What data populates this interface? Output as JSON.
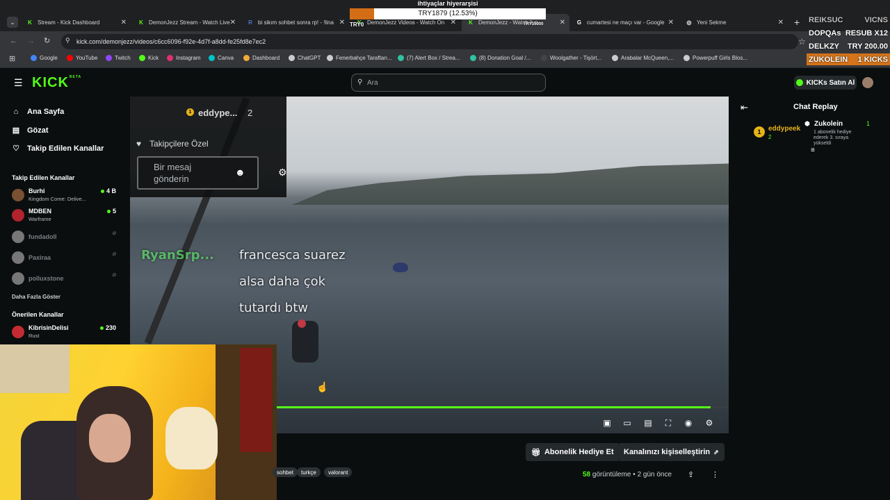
{
  "browser": {
    "tabs": [
      {
        "label": "Stream - Kick Dashboard",
        "fav": "K",
        "color": "#53fc18"
      },
      {
        "label": "DemonJezz Stream - Watch Live",
        "fav": "K",
        "color": "#53fc18"
      },
      {
        "label": "bi sikım sohbet sonra rp! - !lina",
        "fav": "R",
        "color": "#4b74d6"
      },
      {
        "label": "DemonJezz Videos - Watch On",
        "fav": "K",
        "color": "#53fc18"
      },
      {
        "label": "DemonJezz - Watch live",
        "fav": "K",
        "color": "#53fc18"
      },
      {
        "label": "cumartesi ne maçı var - Google",
        "fav": "G",
        "color": "#ffffff"
      },
      {
        "label": "Yeni Sekme",
        "fav": "◎",
        "color": "#ffffff"
      }
    ],
    "url": "kick.com/demonjezz/videos/c6cc6096-f92e-4d7f-a8dd-fe25fd8e7ec2",
    "bookmarks": [
      {
        "label": "Google",
        "color": "#4285f4"
      },
      {
        "label": "YouTube",
        "color": "#ff0000"
      },
      {
        "label": "Twitch",
        "color": "#9146ff"
      },
      {
        "label": "Kick",
        "color": "#53fc18"
      },
      {
        "label": "Instagram",
        "color": "#e1306c"
      },
      {
        "label": "Canva",
        "color": "#00c4cc"
      },
      {
        "label": "Dashboard",
        "color": "#f2a93b"
      },
      {
        "label": "ChatGPT",
        "color": "#cccccc"
      },
      {
        "label": "Fenerbahçe Taraftarı...",
        "color": "#cccccc"
      },
      {
        "label": "(7) Alert Box / Strea...",
        "color": "#31c3a2"
      },
      {
        "label": "(8) Donation Goal /...",
        "color": "#31c3a2"
      },
      {
        "label": "Woolgather - Tişört...",
        "color": "#444444"
      },
      {
        "label": "Arabalar McQueen,...",
        "color": "#cccccc"
      },
      {
        "label": "Powerpuff Girls Blos...",
        "color": "#cccccc"
      }
    ]
  },
  "stream_overlay": {
    "goal_title": "ihtiyaçlar hiyerarşisi",
    "goal_amount": "TRY1879 (12.53%)",
    "goal_progress": 0.1253,
    "goal_start": "TRY0",
    "goal_end": "TRY15000",
    "hud_lines": [
      {
        "left": "REIKSUC",
        "right": "VICNS",
        "color": "#bfbfbf"
      },
      {
        "left": "DOPQAs",
        "right": "RESUB X12",
        "color": "#ffffff"
      },
      {
        "left": "DELKZY",
        "right": "TRY 200.00",
        "color": "#ffffff"
      },
      {
        "left": "ZUKOLEIN",
        "right": "1 KICKS",
        "color": "#ffffff"
      }
    ]
  },
  "header": {
    "logo": "KICK",
    "logo_badge": "BETA",
    "search_placeholder": "Ara",
    "buy_kicks": "KICKs Satın Al"
  },
  "sidebar": {
    "nav": [
      {
        "label": "Ana Sayfa",
        "icon": "⌂"
      },
      {
        "label": "Gözat",
        "icon": "▤"
      },
      {
        "label": "Takip Edilen Kanallar",
        "icon": "♡"
      }
    ],
    "followed_title": "Takip Edilen Kanallar",
    "followed": [
      {
        "name": "Burhi",
        "game": "Kingdom Come: Delive...",
        "viewers": "4 B",
        "live": true,
        "color": "#7a5032"
      },
      {
        "name": "MDBEN",
        "game": "Warframe",
        "viewers": "5",
        "live": true,
        "color": "#b3232e"
      },
      {
        "name": "fundadoll",
        "game": "",
        "viewers": "⌀",
        "live": false,
        "color": "#777777"
      },
      {
        "name": "Paxiraa",
        "game": "",
        "viewers": "⌀",
        "live": false,
        "color": "#777777"
      },
      {
        "name": "polluxstone",
        "game": "",
        "viewers": "⌀",
        "live": false,
        "color": "#777777"
      }
    ],
    "show_more": "Daha Fazla Göster",
    "recommended_title": "Önerilen Kanallar",
    "recommended": [
      {
        "name": "KibrisinDelisi",
        "game": "Rust",
        "viewers": "230",
        "live": true,
        "color": "#c52b32"
      }
    ]
  },
  "video": {
    "embedded_chat": {
      "user": "eddype...",
      "count": "2",
      "followers_only": "Takipçilere Özel",
      "message_placeholder": "Bir mesaj gönderin"
    },
    "burned_caption": {
      "user": "RyanSrp...",
      "lines": [
        "francesca suarez",
        "alsa daha çok",
        "tutardı btw"
      ]
    },
    "progress": 0.96
  },
  "actions": {
    "gift_sub": "Abonelik Hediye Et",
    "customize": "Kanalınızı kişiselleştirin",
    "tags": [
      "sohbet",
      "turkçe",
      "valorant"
    ],
    "views_count": "58",
    "views_label": "görüntüleme",
    "time_ago": "2 gün önce"
  },
  "chat": {
    "title": "Chat Replay",
    "leaderboard": [
      {
        "rank": "1",
        "user": "eddypeek",
        "count": "2"
      }
    ],
    "event": {
      "user": "Zukolein",
      "count": "1",
      "text": "1 abonelik hediye ederek 3. sıraya yükseldi"
    }
  }
}
